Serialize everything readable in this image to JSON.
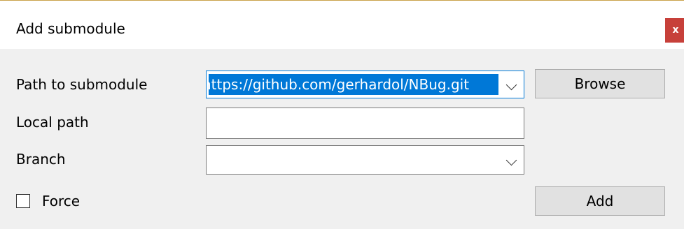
{
  "dialog": {
    "title": "Add submodule",
    "close_glyph": "x"
  },
  "form": {
    "path_label": "Path to submodule",
    "path_value": "https://github.com/gerhardol/NBug.git",
    "browse_label": "Browse",
    "local_path_label": "Local path",
    "local_path_value": "",
    "branch_label": "Branch",
    "branch_value": "",
    "force_label": "Force",
    "force_checked": false,
    "add_label": "Add"
  },
  "colors": {
    "selection": "#0078d7",
    "close_button": "#c7403a",
    "dialog_background": "#f0f0f0"
  },
  "icons": {
    "dropdown": "chevron-down-icon",
    "close": "close-icon"
  }
}
